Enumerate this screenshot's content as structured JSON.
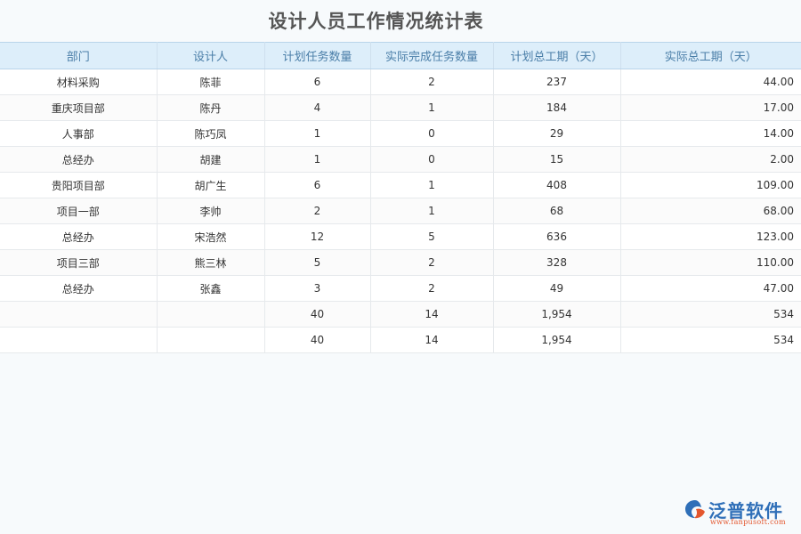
{
  "title": "设计人员工作情况统计表",
  "columns": [
    "部门",
    "设计人",
    "计划任务数量",
    "实际完成任务数量",
    "计划总工期（天）",
    "实际总工期（天）"
  ],
  "rows": [
    [
      "材料采购",
      "陈菲",
      "6",
      "2",
      "237",
      "44.00"
    ],
    [
      "重庆项目部",
      "陈丹",
      "4",
      "1",
      "184",
      "17.00"
    ],
    [
      "人事部",
      "陈巧凤",
      "1",
      "0",
      "29",
      "14.00"
    ],
    [
      "总经办",
      "胡建",
      "1",
      "0",
      "15",
      "2.00"
    ],
    [
      "贵阳项目部",
      "胡广生",
      "6",
      "1",
      "408",
      "109.00"
    ],
    [
      "项目一部",
      "李帅",
      "2",
      "1",
      "68",
      "68.00"
    ],
    [
      "总经办",
      "宋浩然",
      "12",
      "5",
      "636",
      "123.00"
    ],
    [
      "项目三部",
      "熊三林",
      "5",
      "2",
      "328",
      "110.00"
    ],
    [
      "总经办",
      "张鑫",
      "3",
      "2",
      "49",
      "47.00"
    ],
    [
      "",
      "",
      "40",
      "14",
      "1,954",
      "534"
    ],
    [
      "",
      "",
      "40",
      "14",
      "1,954",
      "534"
    ]
  ],
  "logo": {
    "name": "泛普软件",
    "url": "www.fanpusoft.com",
    "brand_color": "#2f6fb8",
    "accent_color": "#e4572e"
  }
}
